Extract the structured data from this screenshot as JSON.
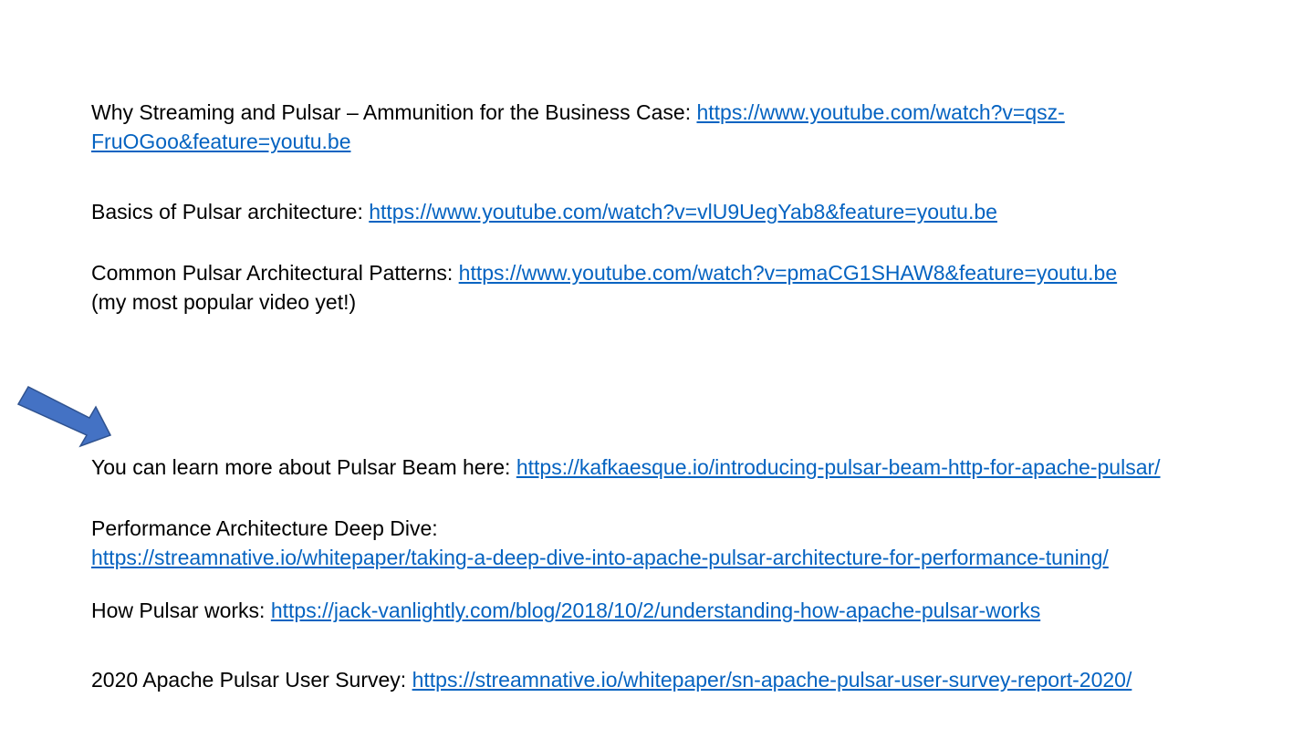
{
  "colors": {
    "link": "#0563c1",
    "text": "#000000",
    "arrow_fill": "#4472c4",
    "arrow_stroke": "#2f528f"
  },
  "items": [
    {
      "label": "Why Streaming and Pulsar – Ammunition for the Business Case: ",
      "link_line1": "https://www.youtube.com/watch?v=qsz-",
      "link_line2": "FruOGoo&feature=youtu.be"
    },
    {
      "label": "Basics of Pulsar architecture: ",
      "link": "https://www.youtube.com/watch?v=vlU9UegYab8&feature=youtu.be"
    },
    {
      "label": "Common Pulsar Architectural Patterns: ",
      "link": "https://www.youtube.com/watch?v=pmaCG1SHAW8&feature=youtu.be",
      "note": "(my most popular video yet!)"
    },
    {
      "label": "You can learn more about Pulsar Beam here: ",
      "link": "https://kafkaesque.io/introducing-pulsar-beam-http-for-apache-pulsar/"
    },
    {
      "label": "Performance Architecture Deep Dive:",
      "link": "https://streamnative.io/whitepaper/taking-a-deep-dive-into-apache-pulsar-architecture-for-performance-tuning/"
    },
    {
      "label": "How Pulsar works: ",
      "link": "https://jack-vanlightly.com/blog/2018/10/2/understanding-how-apache-pulsar-works"
    },
    {
      "label": "2020 Apache Pulsar User Survey: ",
      "link": "https://streamnative.io/whitepaper/sn-apache-pulsar-user-survey-report-2020/"
    }
  ],
  "arrow_icon": "right-arrow-icon"
}
